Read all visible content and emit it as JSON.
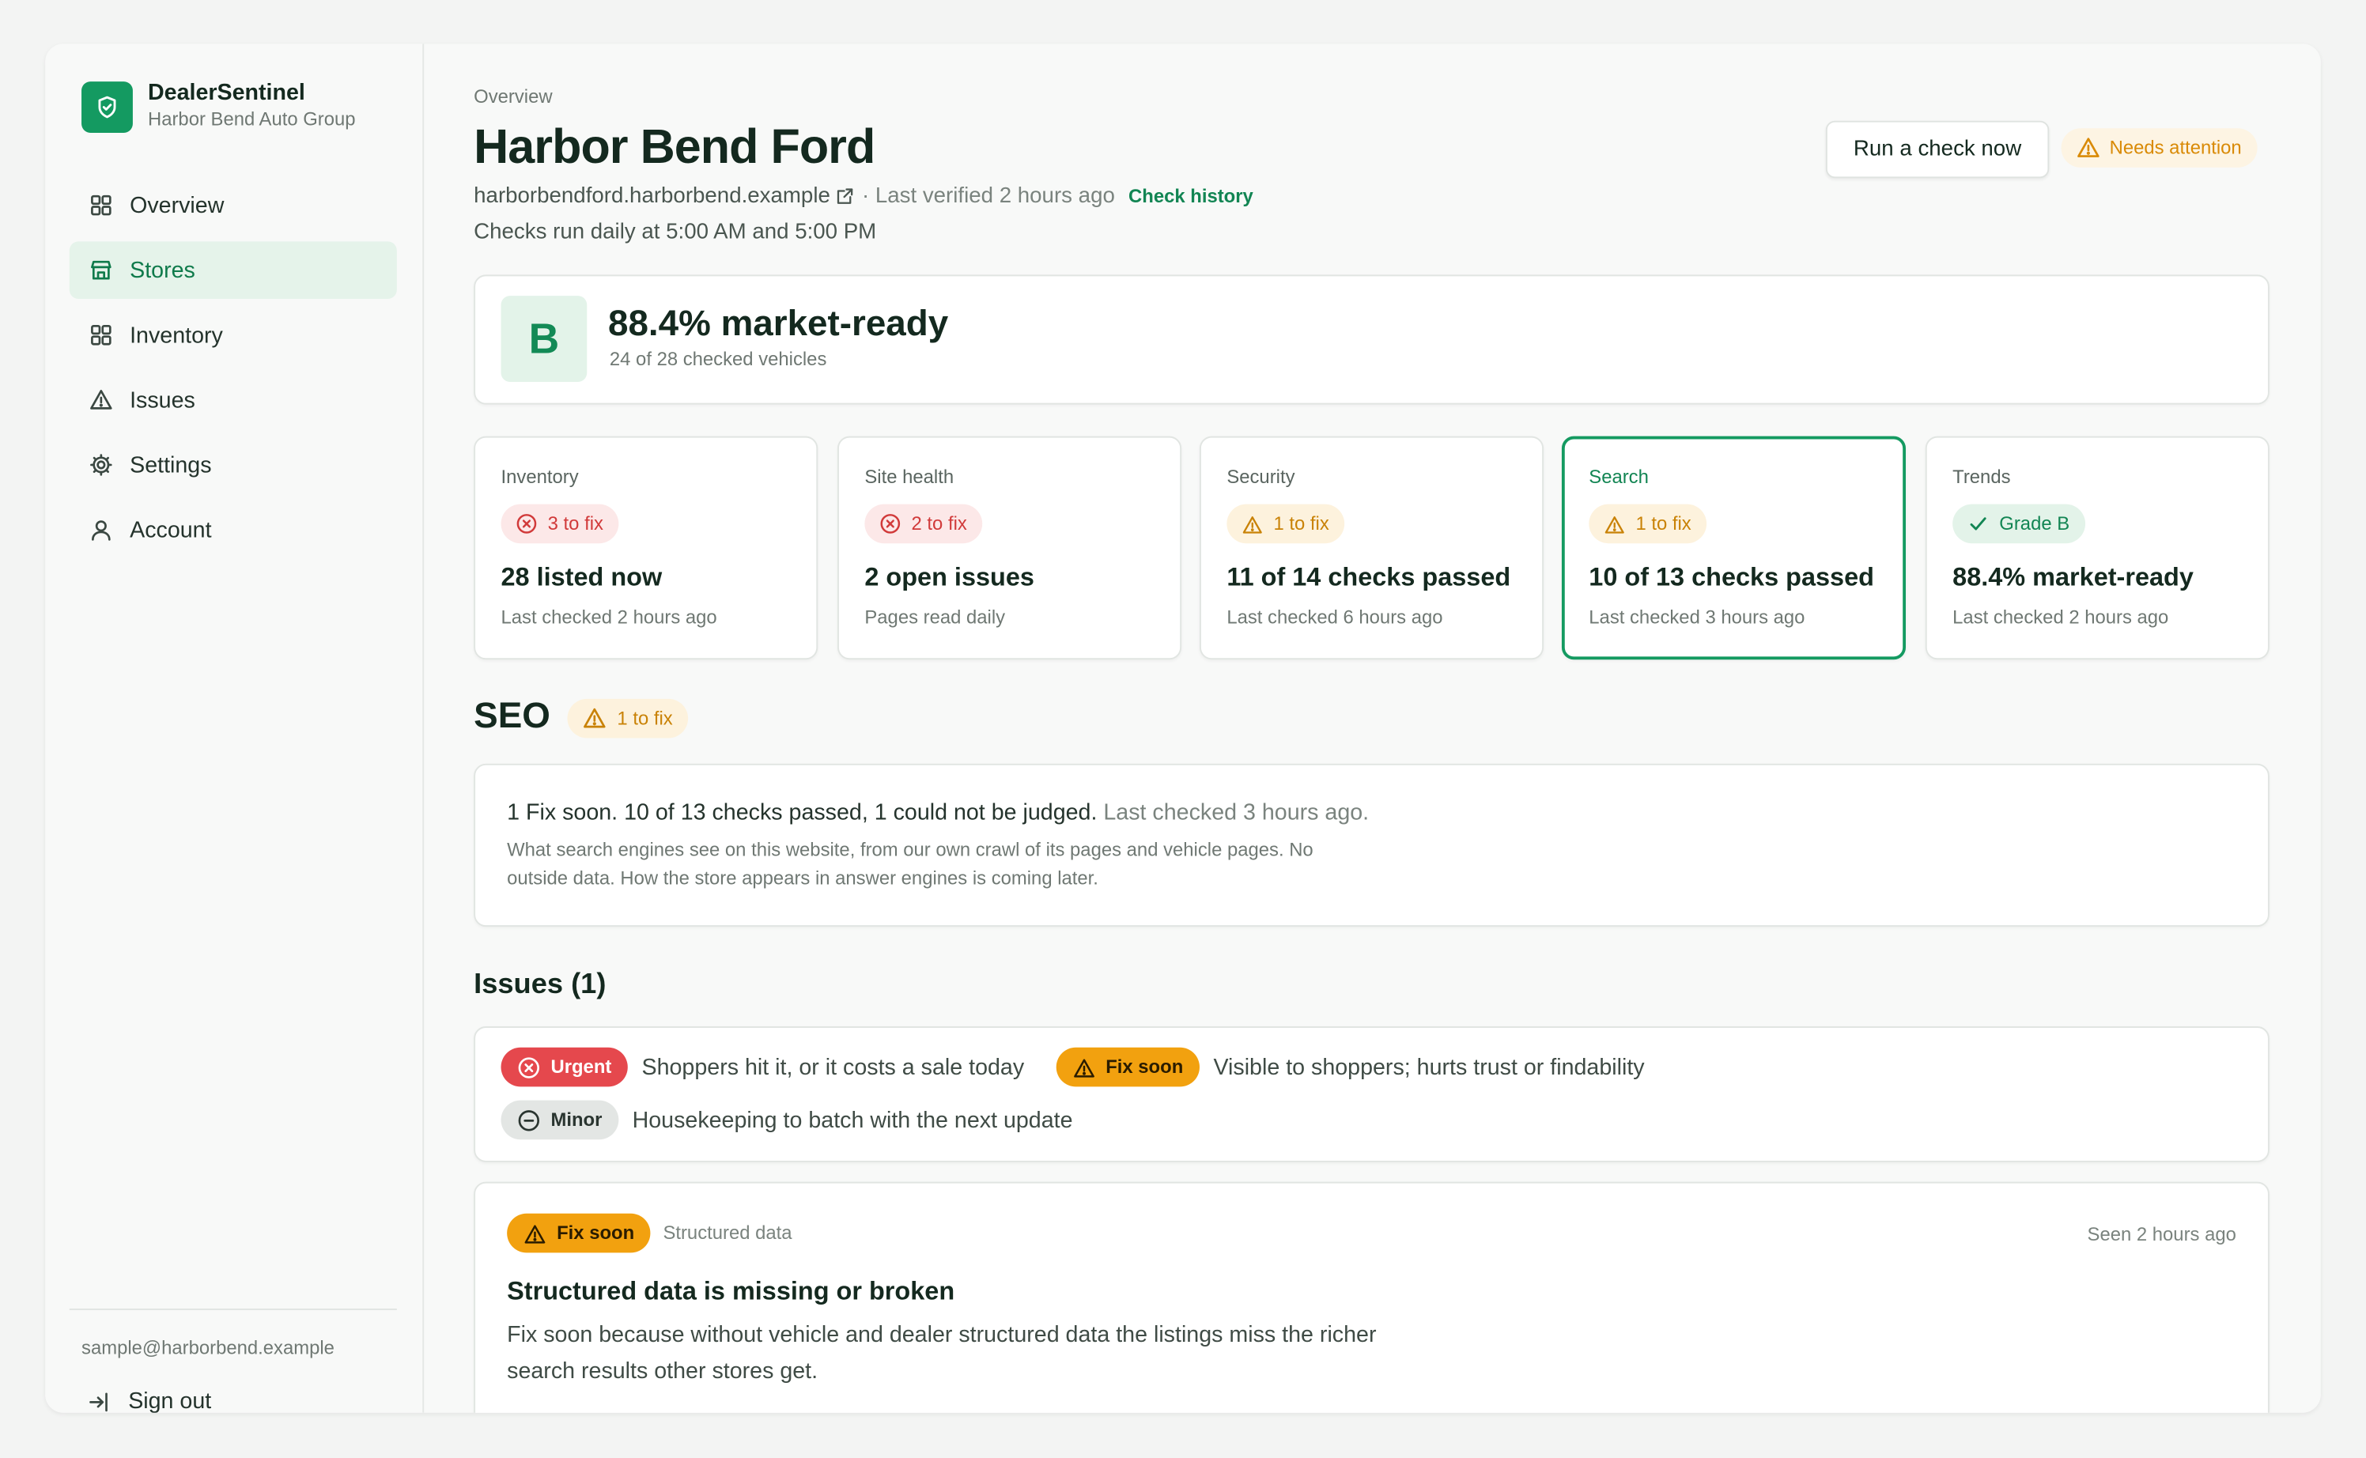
{
  "brand": {
    "name": "DealerSentinel",
    "org": "Harbor Bend Auto Group"
  },
  "nav": [
    {
      "label": "Overview",
      "icon": "grid-icon",
      "active": false
    },
    {
      "label": "Stores",
      "icon": "store-icon",
      "active": true
    },
    {
      "label": "Inventory",
      "icon": "grid-icon",
      "active": false
    },
    {
      "label": "Issues",
      "icon": "warning-icon",
      "active": false
    },
    {
      "label": "Settings",
      "icon": "gear-icon",
      "active": false
    },
    {
      "label": "Account",
      "icon": "user-icon",
      "active": false
    }
  ],
  "user": {
    "email": "sample@harborbend.example",
    "signout_label": "Sign out"
  },
  "header": {
    "eyebrow": "Overview",
    "title": "Harbor Bend Ford",
    "domain": "harborbendford.harborbend.example",
    "verified": "· Last verified 2 hours ago",
    "history_link": "Check history",
    "schedule": "Checks run daily at 5:00 AM and 5:00 PM",
    "run_button": "Run a check now",
    "status": "Needs attention"
  },
  "grade": {
    "letter": "B",
    "headline": "88.4% market-ready",
    "sub": "24 of 28 checked vehicles"
  },
  "stats": [
    {
      "label": "Inventory",
      "pill": "3 to fix",
      "tone": "red",
      "value": "28 listed now",
      "sub": "Last checked 2 hours ago"
    },
    {
      "label": "Site health",
      "pill": "2 to fix",
      "tone": "red",
      "value": "2 open issues",
      "sub": "Pages read daily"
    },
    {
      "label": "Security",
      "pill": "1 to fix",
      "tone": "amber",
      "value": "11 of 14 checks passed",
      "sub": "Last checked 6 hours ago"
    },
    {
      "label": "Search",
      "pill": "1 to fix",
      "tone": "amber",
      "value": "10 of 13 checks passed",
      "sub": "Last checked 3 hours ago",
      "selected": true
    },
    {
      "label": "Trends",
      "pill": "Grade B",
      "tone": "green",
      "value": "88.4% market-ready",
      "sub": "Last checked 2 hours ago"
    }
  ],
  "seo": {
    "heading": "SEO",
    "pill": "1 to fix",
    "summary": "1 Fix soon. 10 of 13 checks passed, 1 could not be judged.",
    "summary_time": "Last checked 3 hours ago.",
    "description": "What search engines see on this website, from our own crawl of its pages and vehicle pages. No outside data. How the store appears in answer engines is coming later."
  },
  "issues": {
    "heading": "Issues (1)",
    "legend": [
      {
        "badge": "Urgent",
        "text": "Shoppers hit it, or it costs a sale today"
      },
      {
        "badge": "Fix soon",
        "text": "Visible to shoppers; hurts trust or findability"
      },
      {
        "badge": "Minor",
        "text": "Housekeeping to batch with the next update"
      }
    ],
    "items": [
      {
        "badge": "Fix soon",
        "category": "Structured data",
        "seen": "Seen 2 hours ago",
        "title": "Structured data is missing or broken",
        "body": "Fix soon because without vehicle and dealer structured data the listings miss the richer search results other stores get."
      }
    ]
  },
  "colors": {
    "accent": "#149a61",
    "urgent": "#e5484d",
    "fix_soon": "#f2a10f",
    "minor": "#e3e6e4"
  }
}
